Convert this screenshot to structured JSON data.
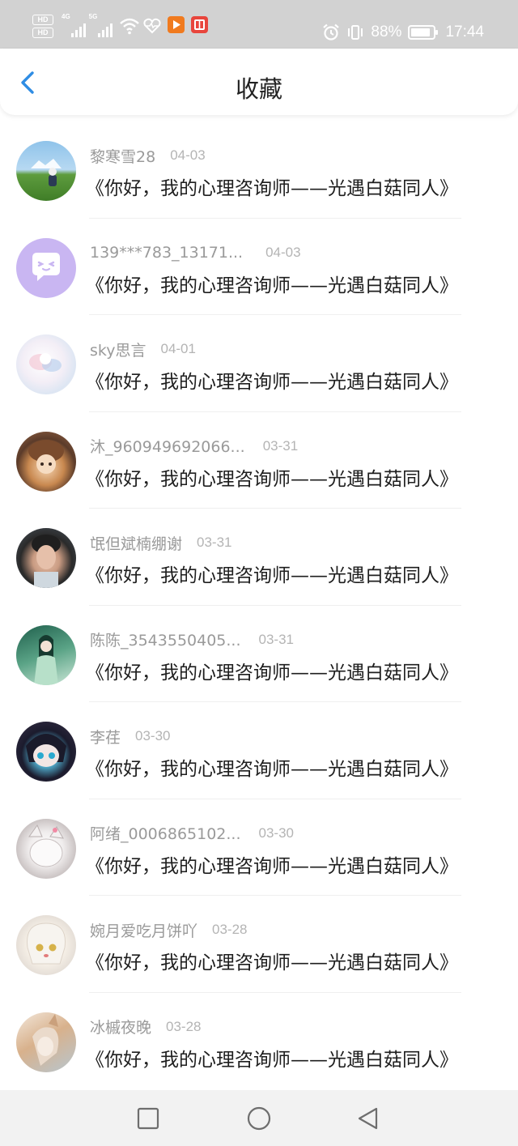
{
  "status_bar": {
    "hd_label": "HD",
    "signal_1_label": "4G",
    "signal_2_label": "5G",
    "battery_percent": "88%",
    "battery_level": 0.88,
    "time": "17:44",
    "icons": [
      "hd-icon",
      "cell-signal-icon",
      "wifi-icon",
      "health-icon",
      "video-app-icon",
      "reader-app-icon",
      "alarm-icon",
      "vibrate-icon",
      "battery-icon"
    ],
    "app_icon_colors": {
      "video": "#f07a1e",
      "reader": "#e8453c"
    }
  },
  "header": {
    "title": "收藏",
    "back_icon": "chevron-left-icon",
    "accent": "#2f8de4"
  },
  "favorites": [
    {
      "username": "黎寒雪28",
      "date": "04-03",
      "title": "《你好，我的心理咨询师——光遇白菇同人》"
    },
    {
      "username": "139***783_13171...",
      "date": "04-03",
      "title": "《你好，我的心理咨询师——光遇白菇同人》"
    },
    {
      "username": "sky思言",
      "date": "04-01",
      "title": "《你好，我的心理咨询师——光遇白菇同人》"
    },
    {
      "username": "沐_960949692066...",
      "date": "03-31",
      "title": "《你好，我的心理咨询师——光遇白菇同人》"
    },
    {
      "username": "氓但斌楠绷谢",
      "date": "03-31",
      "title": "《你好，我的心理咨询师——光遇白菇同人》"
    },
    {
      "username": "陈陈_3543550405...",
      "date": "03-31",
      "title": "《你好，我的心理咨询师——光遇白菇同人》"
    },
    {
      "username": "李荏",
      "date": "03-30",
      "title": "《你好，我的心理咨询师——光遇白菇同人》"
    },
    {
      "username": "阿绪_0006865102...",
      "date": "03-30",
      "title": "《你好，我的心理咨询师——光遇白菇同人》"
    },
    {
      "username": "婉月爱吃月饼吖",
      "date": "03-28",
      "title": "《你好，我的心理咨询师——光遇白菇同人》"
    },
    {
      "username": "冰槭夜晚",
      "date": "03-28",
      "title": "《你好，我的心理咨询师——光遇白菇同人》"
    }
  ],
  "nav_bar": {
    "icons": [
      "recent-apps-square-icon",
      "home-circle-icon",
      "back-triangle-icon"
    ]
  }
}
